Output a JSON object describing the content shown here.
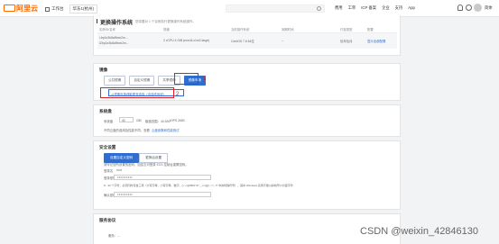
{
  "topbar": {
    "logo_text": "阿里云",
    "workspace": "工作台",
    "region": "华东1(杭州)",
    "nav": [
      "费用",
      "工单",
      "ICP 备案",
      "企业",
      "支持",
      "App"
    ],
    "lang": "简体"
  },
  "header": {
    "title": "更换操作系统",
    "note": "您将要对 1 个实例执行更换操作系统操作。",
    "columns": [
      "实例ID/名称",
      "规格",
      "当前操作系统",
      "到期时间",
      "付费类型",
      "配置"
    ],
    "row": {
      "instance_id": "i-bp1e3k8a9bxe2m...",
      "instance_name": "iZbp1e3k8a9bxe2m...",
      "spec": "2 vCPU 4 GiB (ecs.t6-c1m2.large)",
      "os": "CentOS 7.6 64位",
      "expiry": "--",
      "pay_type": "包年包月",
      "config_link": "显示全部配置"
    }
  },
  "reinstall": {
    "title": "镜像",
    "tabs": [
      "公共镜像",
      "自定义镜像",
      "共享镜像",
      "镜像市场"
    ],
    "image_select": "从镜像市场获取更多选择（含操作系统）",
    "annotations": [
      "1",
      "2"
    ]
  },
  "disk": {
    "title": "系统盘",
    "size_label": "系统盘",
    "size_value": "40",
    "size_unit": "GiB",
    "size_range": "取值范围：40-500",
    "iops": "IOPS 2680",
    "hint": "不同云盘的费用及性能不同，查看",
    "hint_link": "云盘参数和性能测试"
  },
  "security": {
    "title": "安全设置",
    "tabs": [
      "设置自定义密码",
      "更换后设置"
    ],
    "desc": "请牢记您所设置的密码，如遗忘可登录 ECS 控制台重置密码。",
    "login_label": "登录名",
    "login_value": "root",
    "pw_label": "登录密码",
    "pw_value": "••••••••••",
    "pw_rule": "8 - 30 个字符，必须同时包含三项（大写字母、小写字母、数字、()`~!@#$%^&*-_+=|{}[]:;'<>,.?/ 中的特殊符号），其中 Windows 实例不能以斜线号(/)为首字符",
    "confirm_label": "确认密码",
    "confirm_value": "••••••••••"
  },
  "service": {
    "title": "服务协议",
    "line": "服务：--"
  },
  "watermark": "CSDN @weixin_42846130"
}
